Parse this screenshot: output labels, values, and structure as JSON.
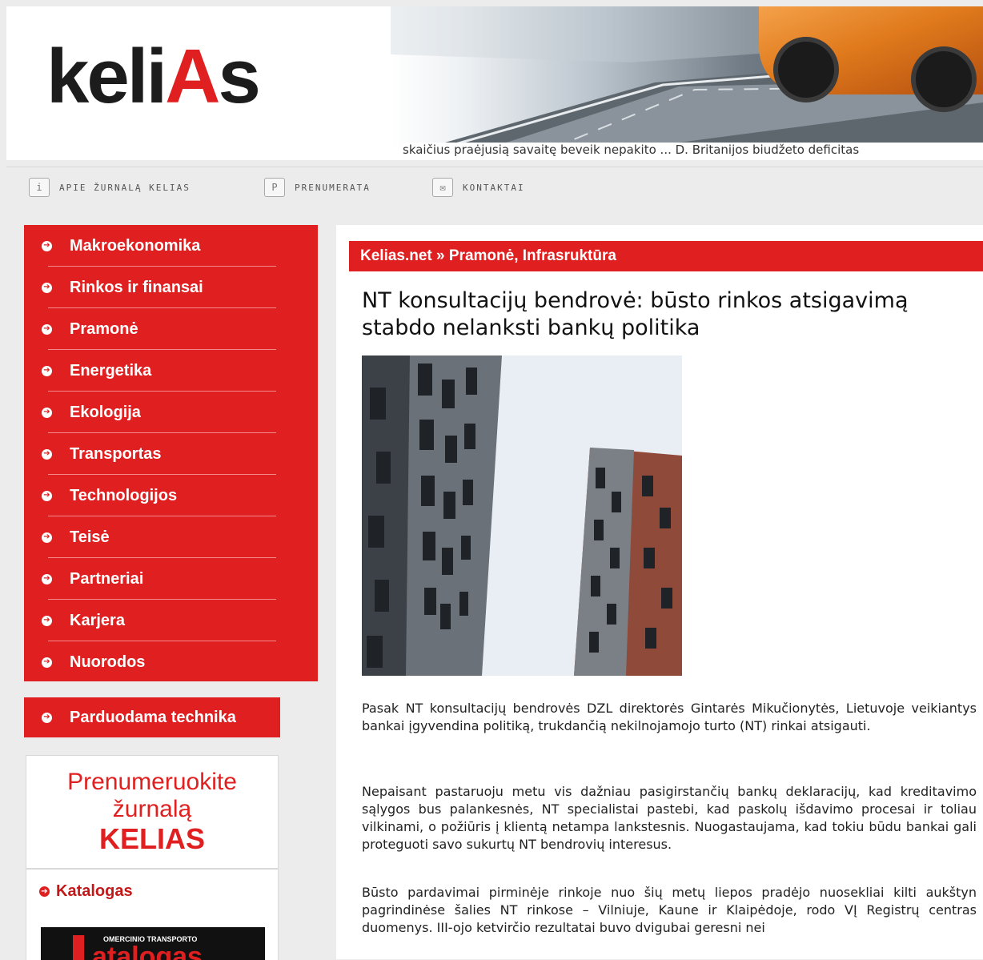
{
  "header": {
    "logo_text": "keli",
    "logo_accent": "A",
    "logo_tail": "s",
    "ticker": "skaičius praėjusią savaitę beveik nepakito ... D. Britanijos biudžeto deficitas"
  },
  "topnav": [
    {
      "icon": "info-icon",
      "label": "APIE ŽURNALĄ KELIAS"
    },
    {
      "icon": "subscription-icon",
      "label": "PRENUMERATA"
    },
    {
      "icon": "envelope-icon",
      "label": "KONTAKTAI"
    }
  ],
  "menu": [
    {
      "label": "Makroekonomika"
    },
    {
      "label": "Rinkos ir finansai"
    },
    {
      "label": "Pramonė"
    },
    {
      "label": "Energetika"
    },
    {
      "label": "Ekologija"
    },
    {
      "label": "Transportas"
    },
    {
      "label": "Technologijos"
    },
    {
      "label": "Teisė"
    },
    {
      "label": "Partneriai"
    },
    {
      "label": "Karjera"
    },
    {
      "label": "Nuorodos"
    }
  ],
  "sale_button": "Parduodama technika",
  "promo": {
    "line1": "Prenumeruokite",
    "line2": "žurnalą",
    "line3": "KELIAS"
  },
  "catalog": {
    "title": "Katalogas",
    "banner_small": "OMERCINIO TRANSPORTO",
    "banner_big": "atalogas"
  },
  "article": {
    "breadcrumb": "Kelias.net » Pramonė, Infrasruktūra",
    "title": "NT konsultacijų bendrovė: būsto rinkos atsigavimą stabdo nelanksti bankų politika",
    "paragraphs": [
      "Pasak NT konsultacijų bendrovės DZL direktorės Gintarės Mikučionytės, Lietuvoje veikiantys bankai įgyvendina politiką, trukdančią nekilnojamojo turto (NT) rinkai atsigauti.",
      "Nepaisant pastaruoju metu vis dažniau pasigirstančių bankų deklaracijų, kad kreditavimo sąlygos bus palankesnės, NT specialistai pastebi, kad paskolų išdavimo procesai ir toliau vilkinami, o požiūris į klientą netampa lankstesnis. Nuogastaujama, kad tokiu būdu bankai gali proteguoti savo sukurtų NT bendrovių interesus.",
      "Būsto pardavimai pirminėje rinkoje nuo šių metų liepos pradėjo nuosekliai kilti aukštyn pagrindinėse šalies NT rinkose – Vilniuje, Kaune ir Klaipėdoje, rodo VĮ Registrų centras duomenys. III-ojo ketvirčio rezultatai buvo dvigubai geresni nei"
    ]
  }
}
